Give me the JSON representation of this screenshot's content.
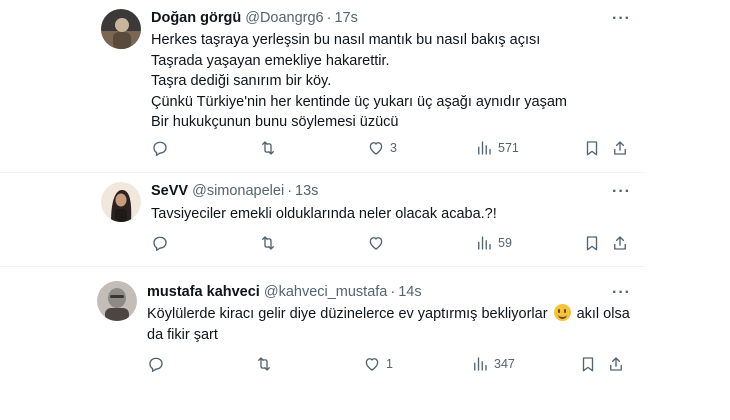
{
  "tweets": [
    {
      "name": "Doğan görgü",
      "handle": "@Doangrg6",
      "separator": "·",
      "time": "17s",
      "more": "···",
      "lines": [
        "Herkes taşraya yerleşsin bu nasıl mantık bu nasıl bakış açısı",
        "Taşrada yaşayan emekliye hakarettir.",
        "Taşra dediği sanırım bir köy.",
        "Çünkü Türkiye'nin her kentinde üç yukarı üç aşağı aynıdır yaşam",
        "Bir hukukçunun bunu söylemesi üzücü"
      ],
      "replies": "",
      "retweets": "",
      "likes": "3",
      "views": "571",
      "avatar_colors": [
        "#3c3a38",
        "#c9b69a",
        "#7a6652"
      ]
    },
    {
      "name": "SeVV",
      "handle": "@simonapelei",
      "separator": "·",
      "time": "13s",
      "more": "···",
      "lines": [
        "Tavsiyeciler emekli olduklarında neler olacak acaba.?!"
      ],
      "replies": "",
      "retweets": "",
      "likes": "",
      "views": "59",
      "avatar_colors": [
        "#f1e7dc",
        "#2b2320",
        "#c89b7b"
      ]
    },
    {
      "name": "mustafa kahveci",
      "handle": "@kahveci_mustafa",
      "separator": "·",
      "time": "14s",
      "more": "···",
      "line1_before": "Köylülerde kiracı gelir diye düzinelerce ev yaptırmış bekliyorlar",
      "emoji": "grinning-face",
      "line1_after": "akıl olsa",
      "line2": "da fikir şart",
      "replies": "",
      "retweets": "",
      "likes": "1",
      "views": "347",
      "avatar_colors": [
        "#8d8a86",
        "#4b4644",
        "#c2bdb7"
      ]
    }
  ]
}
